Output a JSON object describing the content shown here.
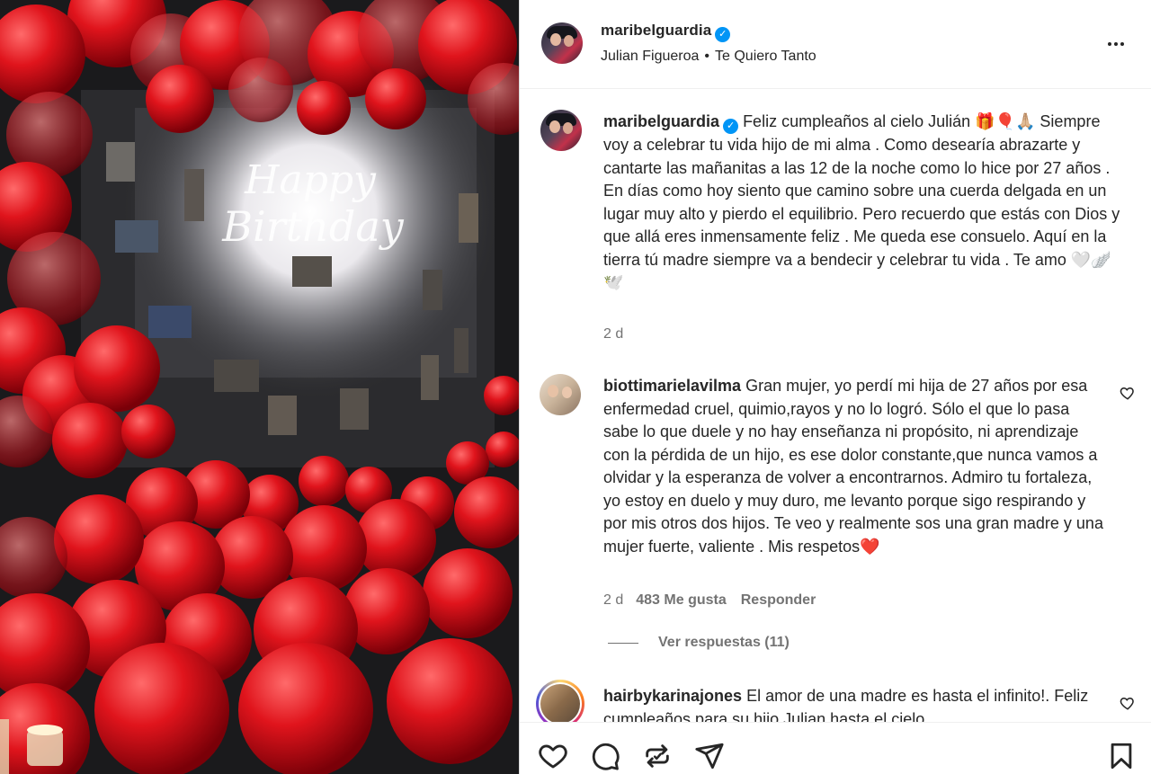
{
  "post": {
    "author": "maribelguardia",
    "music_artist": "Julian Figueroa",
    "separator": "•",
    "music_title": "Te Quiero Tanto",
    "verified_glyph": "✓"
  },
  "media": {
    "neon_line1": "Happy",
    "neon_line2": "Birthday"
  },
  "caption": {
    "user": "maribelguardia",
    "text": "Feliz cumpleaños al cielo Julián 🎁🎈🙏🏼 Siempre voy a celebrar tu vida hijo de mi alma . Como desearía abrazarte y cantarte las mañanitas a las 12 de la noche como lo hice por 27 años . En días como hoy siento que camino sobre una cuerda delgada en un lugar muy alto y pierdo el equilibrio. Pero recuerdo que estás con Dios y que allá eres inmensamente feliz . Me queda ese consuelo. Aquí en la tierra tú madre siempre va a bendecir y celebrar tu vida . Te amo 🤍🪽🕊️",
    "time": "2 d"
  },
  "comments": [
    {
      "user": "biottimarielavilma",
      "text": "Gran mujer, yo perdí mi hija de 27 años por esa enfermedad cruel, quimio,rayos y no lo logró. Sólo el que lo pasa sabe lo que duele y no hay enseñanza ni propósito, ni aprendizaje con la pérdida de un hijo, es ese dolor constante,que nunca vamos a olvidar y la esperanza de volver a encontrarnos. Admiro tu fortaleza, yo estoy en duelo y muy duro, me levanto porque sigo respirando y por mis otros dos hijos. Te veo y realmente sos una gran madre y una mujer fuerte, valiente . Mis respetos❤️",
      "time": "2 d",
      "likes": "483 Me gusta",
      "reply": "Responder",
      "view_replies": "Ver respuestas (11)"
    },
    {
      "user": "hairbykarinajones",
      "text": "El amor de una madre es hasta el infinito!. Feliz cumpleaños para su hijo Julian hasta el cielo"
    }
  ],
  "icons": {
    "more": "more-horizontal-icon",
    "like": "heart-icon",
    "comment": "comment-icon",
    "share": "repost-icon",
    "send": "send-icon",
    "save": "bookmark-icon"
  },
  "colors": {
    "verified": "#0095f6",
    "muted": "#737373",
    "text": "#262626",
    "balloon": "#d8141c"
  }
}
